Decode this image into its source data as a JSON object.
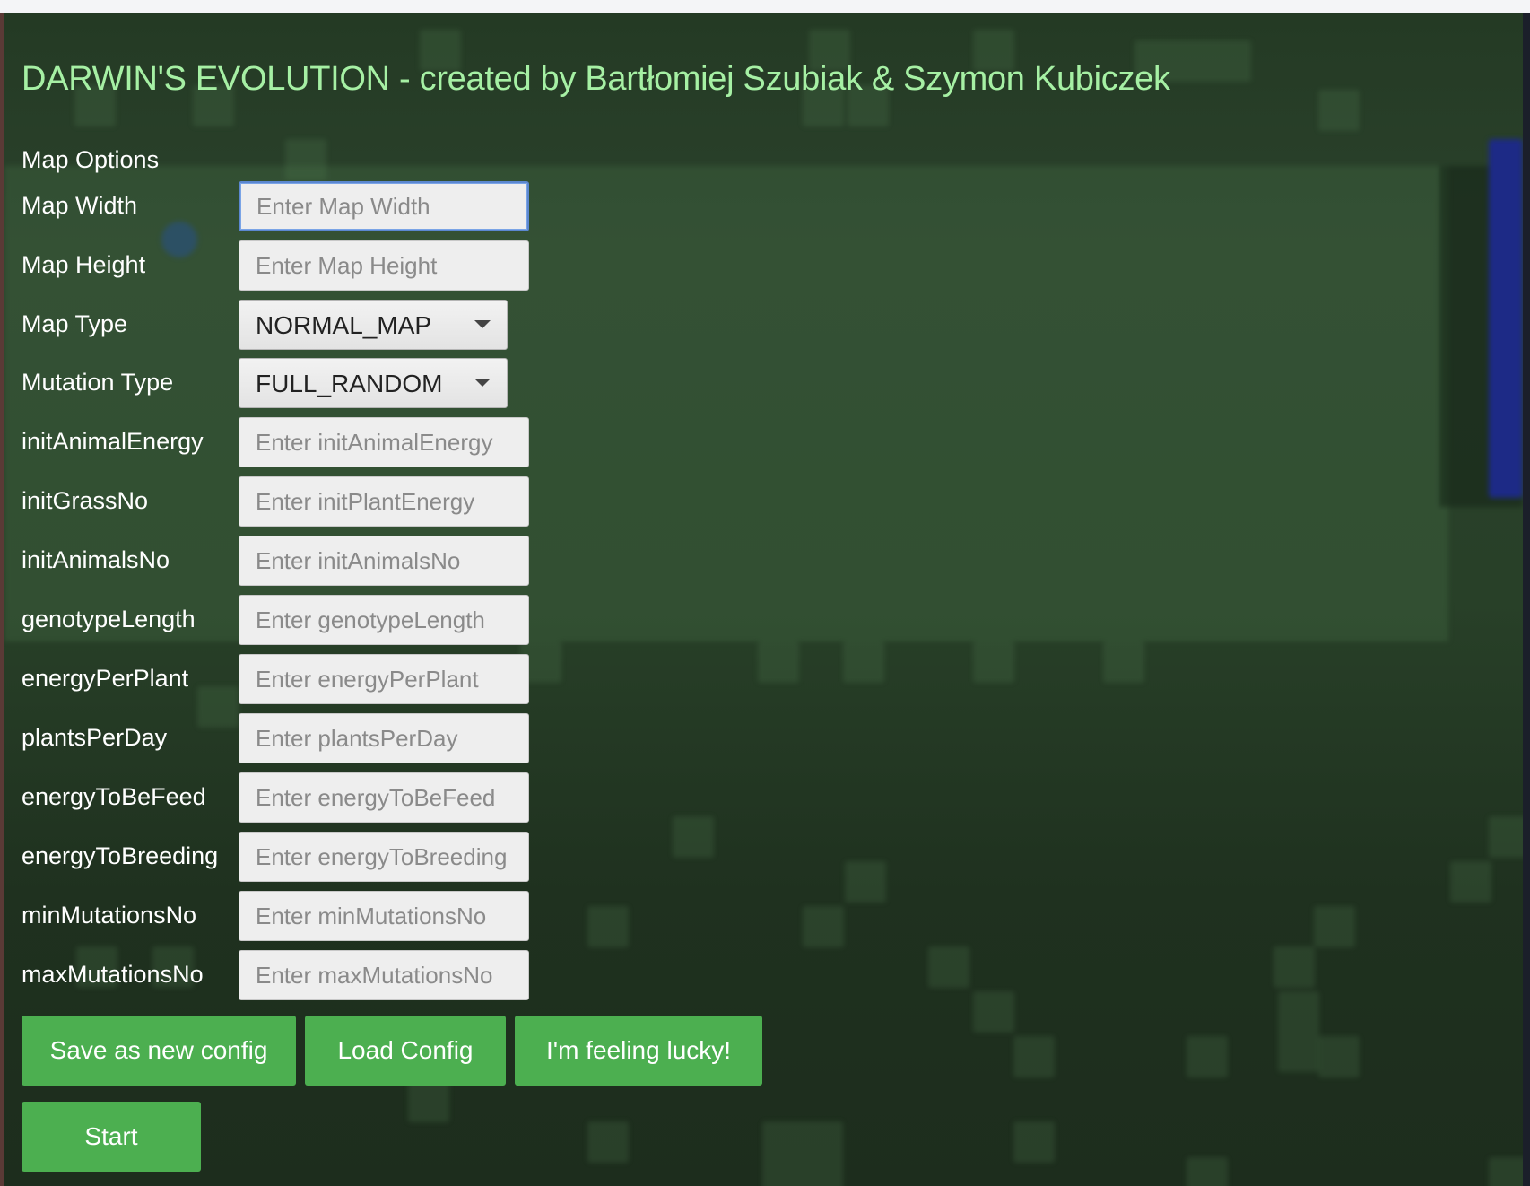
{
  "app": {
    "title": "DARWIN'S EVOLUTION - created by Bartłomiej Szubiak & Szymon Kubiczek",
    "section_title": "Map Options"
  },
  "fields": [
    {
      "label": "Map Width",
      "placeholder": "Enter Map Width",
      "value": ""
    },
    {
      "label": "Map Height",
      "placeholder": "Enter Map Height",
      "value": ""
    },
    {
      "label": "initAnimalEnergy",
      "placeholder": "Enter initAnimalEnergy",
      "value": ""
    },
    {
      "label": "initGrassNo",
      "placeholder": "Enter initPlantEnergy",
      "value": ""
    },
    {
      "label": "initAnimalsNo",
      "placeholder": "Enter initAnimalsNo",
      "value": ""
    },
    {
      "label": "genotypeLength",
      "placeholder": "Enter genotypeLength",
      "value": ""
    },
    {
      "label": "energyPerPlant",
      "placeholder": "Enter energyPerPlant",
      "value": ""
    },
    {
      "label": "plantsPerDay",
      "placeholder": "Enter plantsPerDay",
      "value": ""
    },
    {
      "label": "energyToBeFeed",
      "placeholder": "Enter energyToBeFeed",
      "value": ""
    },
    {
      "label": "energyToBreeding",
      "placeholder": "Enter energyToBreeding",
      "value": ""
    },
    {
      "label": "minMutationsNo",
      "placeholder": "Enter minMutationsNo",
      "value": ""
    },
    {
      "label": "maxMutationsNo",
      "placeholder": "Enter maxMutationsNo",
      "value": ""
    }
  ],
  "selects": [
    {
      "label": "Map Type",
      "value": "NORMAL_MAP"
    },
    {
      "label": "Mutation Type",
      "value": "FULL_RANDOM"
    }
  ],
  "buttons": {
    "save": "Save as new config",
    "load": "Load Config",
    "lucky": "I'm feeling lucky!",
    "start": "Start"
  },
  "colors": {
    "title": "#a6f0a4",
    "button": "#4caf50",
    "background": "#1f311f"
  }
}
